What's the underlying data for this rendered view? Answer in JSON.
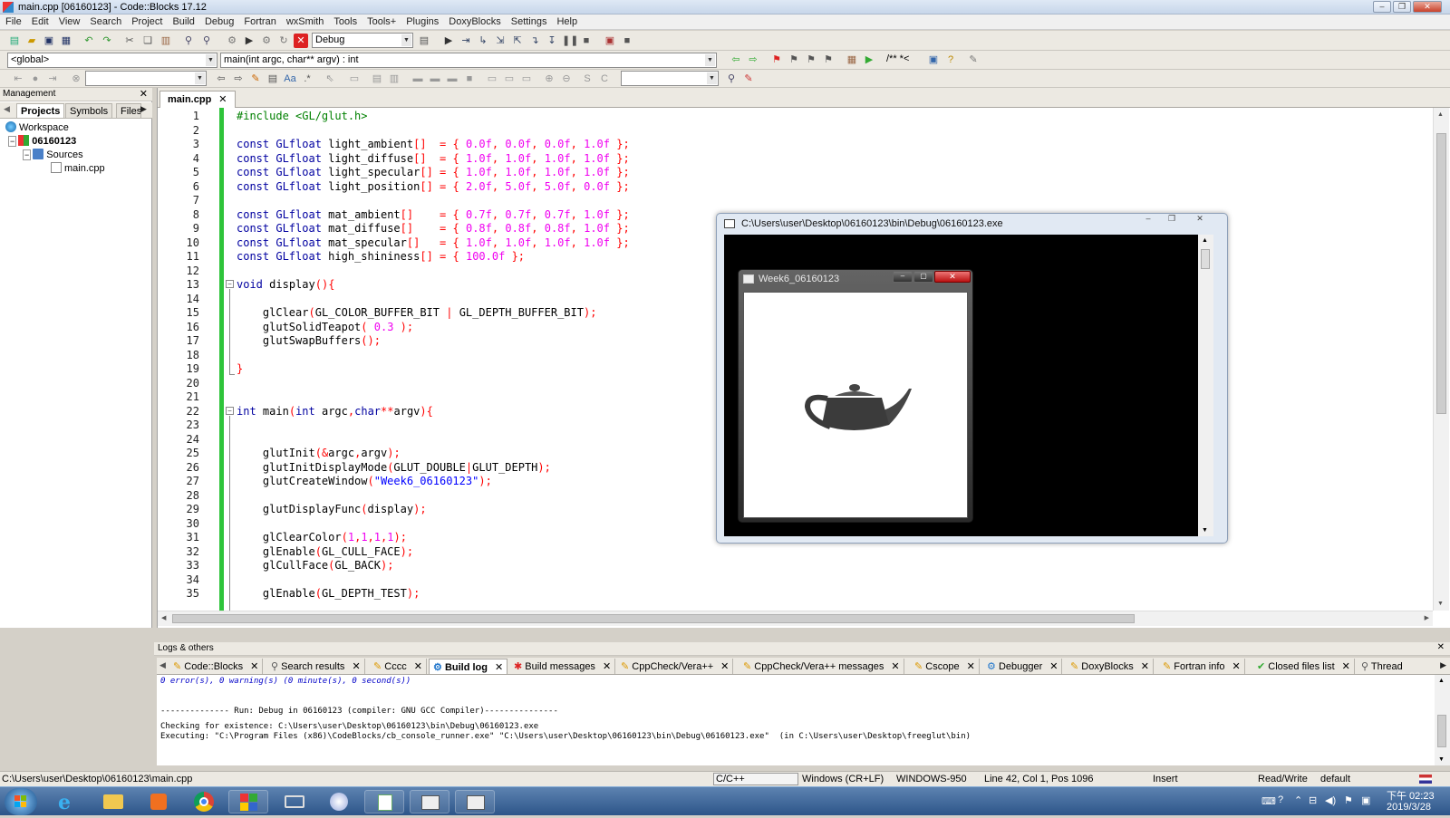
{
  "window": {
    "title": "main.cpp [06160123] - Code::Blocks 17.12"
  },
  "menu": [
    "File",
    "Edit",
    "View",
    "Search",
    "Project",
    "Build",
    "Debug",
    "Fortran",
    "wxSmith",
    "Tools",
    "Tools+",
    "Plugins",
    "DoxyBlocks",
    "Settings",
    "Help"
  ],
  "toolbar": {
    "build_target": "Debug",
    "scope": "<global>",
    "function": "main(int argc, char** argv) : int",
    "comment_labels": "/** *<"
  },
  "management": {
    "title": "Management",
    "tabs": [
      "Projects",
      "Symbols",
      "Files"
    ],
    "tree": {
      "workspace": "Workspace",
      "project": "06160123",
      "folder": "Sources",
      "file": "main.cpp"
    }
  },
  "editor": {
    "tab": "main.cpp",
    "lines": [
      "#include <GL/glut.h>",
      "",
      "const GLfloat light_ambient[]  = { 0.0f, 0.0f, 0.0f, 1.0f };",
      "const GLfloat light_diffuse[]  = { 1.0f, 1.0f, 1.0f, 1.0f };",
      "const GLfloat light_specular[] = { 1.0f, 1.0f, 1.0f, 1.0f };",
      "const GLfloat light_position[] = { 2.0f, 5.0f, 5.0f, 0.0f };",
      "",
      "const GLfloat mat_ambient[]    = { 0.7f, 0.7f, 0.7f, 1.0f };",
      "const GLfloat mat_diffuse[]    = { 0.8f, 0.8f, 0.8f, 1.0f };",
      "const GLfloat mat_specular[]   = { 1.0f, 1.0f, 1.0f, 1.0f };",
      "const GLfloat high_shininess[] = { 100.0f };",
      "",
      "void display(){",
      "",
      "    glClear(GL_COLOR_BUFFER_BIT | GL_DEPTH_BUFFER_BIT);",
      "    glutSolidTeapot( 0.3 );",
      "    glutSwapBuffers();",
      "",
      "}",
      "",
      "",
      "int main(int argc,char**argv){",
      "",
      "",
      "    glutInit(&argc,argv);",
      "    glutInitDisplayMode(GLUT_DOUBLE|GLUT_DEPTH);",
      "    glutCreateWindow(\"Week6_06160123\");",
      "",
      "    glutDisplayFunc(display);",
      "",
      "    glClearColor(1,1,1,1);",
      "    glEnable(GL_CULL_FACE);",
      "    glCullFace(GL_BACK);",
      "",
      "    glEnable(GL_DEPTH_TEST);"
    ],
    "line_numbers": [
      "1",
      "2",
      "3",
      "4",
      "5",
      "6",
      "7",
      "8",
      "9",
      "10",
      "11",
      "12",
      "13",
      "14",
      "15",
      "16",
      "17",
      "18",
      "19",
      "20",
      "21",
      "22",
      "23",
      "24",
      "25",
      "26",
      "27",
      "28",
      "29",
      "30",
      "31",
      "32",
      "33",
      "34",
      "35"
    ],
    "colors": {
      "keyword": "#0000a0",
      "number": "#f000f0",
      "string": "#0000ff",
      "preproc": "#008000",
      "operator": "#ff0000",
      "text": "#000000"
    }
  },
  "console_window": {
    "title": "C:\\Users\\user\\Desktop\\06160123\\bin\\Debug\\06160123.exe"
  },
  "gl_window": {
    "title": "Week6_06160123"
  },
  "logs": {
    "title": "Logs & others",
    "tabs": [
      "Code::Blocks",
      "Search results",
      "Cccc",
      "Build log",
      "Build messages",
      "CppCheck/Vera++",
      "CppCheck/Vera++ messages",
      "Cscope",
      "Debugger",
      "DoxyBlocks",
      "Fortran info",
      "Closed files list",
      "Thread"
    ],
    "active_tab": "Build log",
    "lines": [
      "0 error(s), 0 warning(s) (0 minute(s), 0 second(s))",
      "",
      "",
      "-------------- Run: Debug in 06160123 (compiler: GNU GCC Compiler)---------------",
      "",
      "Checking for existence: C:\\Users\\user\\Desktop\\06160123\\bin\\Debug\\06160123.exe",
      "Executing: \"C:\\Program Files (x86)\\CodeBlocks/cb_console_runner.exe\" \"C:\\Users\\user\\Desktop\\06160123\\bin\\Debug\\06160123.exe\"  (in C:\\Users\\user\\Desktop\\freeglut\\bin)"
    ]
  },
  "status": {
    "path": "C:\\Users\\user\\Desktop\\06160123\\main.cpp",
    "lang": "C/C++",
    "eol": "Windows (CR+LF)",
    "encoding": "WINDOWS-950",
    "position": "Line 42, Col 1, Pos 1096",
    "mode": "Insert",
    "access": "Read/Write",
    "profile": "default"
  },
  "taskbar": {
    "time": "下午 02:23",
    "date": "2019/3/28"
  }
}
